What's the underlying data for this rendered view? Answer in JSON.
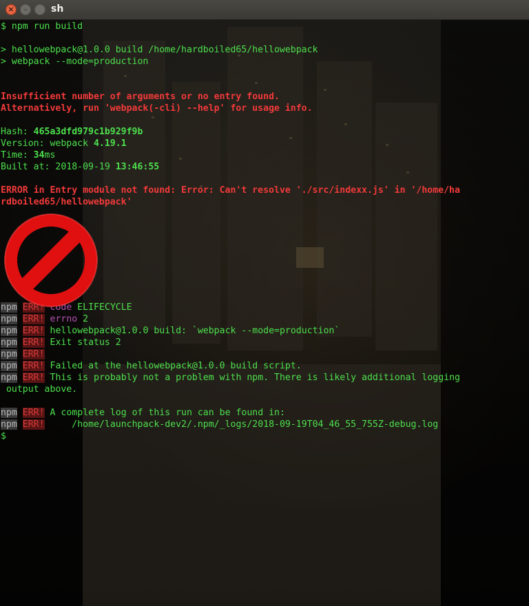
{
  "window": {
    "title": "sh"
  },
  "terminal": {
    "l1": "$ npm run build",
    "l2": "> hellowebpack@1.0.0 build /home/hardboiled65/hellowebpack",
    "l3": "> webpack --mode=production",
    "l4": "Insufficient number of arguments or no entry found.",
    "l5": "Alternatively, run 'webpack(-cli) --help' for usage info.",
    "hash_label": "Hash: ",
    "hash_value": "465a3dfd979c1b929f9b",
    "version_label": "Version: webpack ",
    "version_value": "4.19.1",
    "time_label": "Time: ",
    "time_value": "34",
    "time_unit": "ms",
    "built_label": "Built at: 2018-09-19 ",
    "built_time": "13:46:55",
    "error_line1": "ERROR in Entry module not found: Error: Can't resolve './src/indexx.js' in '/home/ha",
    "error_line2": "rdboiled65/hellowebpack'",
    "npm_tag": "npm",
    "err_tag": "ERR!",
    "npm_l1_key": "code",
    "npm_l1_val": " ELIFECYCLE",
    "npm_l2_key": "errno",
    "npm_l2_val": " 2",
    "npm_l3": "hellowebpack@1.0.0 build: `webpack --mode=production`",
    "npm_l4": "Exit status 2",
    "npm_l6": "Failed at the hellowebpack@1.0.0 build script.",
    "npm_l7": "This is probably not a problem with npm. There is likely additional logging",
    "npm_l7b": " output above.",
    "npm_l8": "A complete log of this run can be found in:",
    "npm_l9": "    /home/launchpack-dev2/.npm/_logs/2018-09-19T04_46_55_755Z-debug.log",
    "prompt": "$"
  },
  "colors": {
    "prompt_green": "#4de04d",
    "error_red": "#f23a3a",
    "stop_icon_red": "#e01010"
  },
  "icons": {
    "stop": "prohibited-sign-icon"
  }
}
